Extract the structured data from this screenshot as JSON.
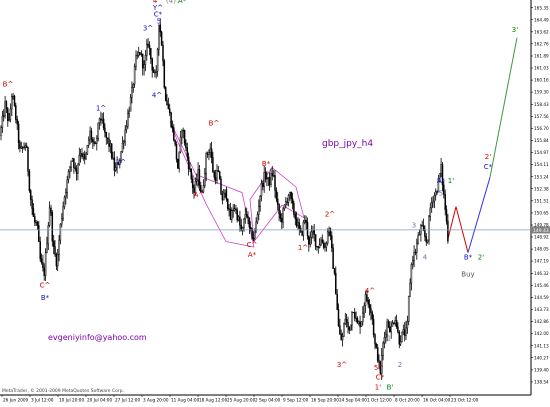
{
  "chart_data": {
    "type": "candlestick",
    "title": "gbp_jpy_h4",
    "annotations": {
      "email": "evgeniyinfo@yahoo.com",
      "copyright": "MetaTrader, © 2001-2009 MetaQuotes Software Corp.",
      "buy": "Buy"
    },
    "price_scale": {
      "ylim": [
        137.6,
        165.9
      ],
      "ticks": [
        "165.35",
        "164.49",
        "163.62",
        "162.76",
        "161.89",
        "161.03",
        "160.16",
        "159.30",
        "158.43",
        "157.56",
        "156.70",
        "155.84",
        "154.97",
        "154.11",
        "153.24",
        "152.38",
        "151.51",
        "150.65",
        "149.78",
        "148.92",
        "148.05",
        "147.19",
        "146.32",
        "145.46",
        "144.59",
        "143.73",
        "142.86",
        "142.00",
        "141.13",
        "140.27",
        "139.40",
        "138.54"
      ],
      "current_price": "149.43",
      "current_price_value": 149.43
    },
    "time_scale": {
      "ticks": [
        "26 Jun 2009",
        "3 Jul 12:00",
        "10 Jul 20:00",
        "20 Jul 04:00",
        "27 Jul 12:00",
        "3 Aug 20:00",
        "11 Aug 04:00",
        "18 Aug 12:00",
        "25 Aug 20:00",
        "2 Sep 04:00",
        "9 Sep 12:00",
        "16 Sep 20:00",
        "24 Sep 04:00",
        "1 Oct 12:00",
        "8 Oct 20:00",
        "16 Oct 04:00",
        "23 Oct 12:00"
      ]
    },
    "price_path": [
      [
        0,
        156.2
      ],
      [
        5,
        158.4
      ],
      [
        9,
        157.0
      ],
      [
        12,
        159.3
      ],
      [
        16,
        157.4
      ],
      [
        20,
        155.0
      ],
      [
        26,
        155.6
      ],
      [
        30,
        152.0
      ],
      [
        34,
        150.0
      ],
      [
        37,
        149.8
      ],
      [
        40,
        147.3
      ],
      [
        44,
        146.2
      ],
      [
        47,
        148.8
      ],
      [
        50,
        151.5
      ],
      [
        53,
        148.2
      ],
      [
        57,
        147.0
      ],
      [
        60,
        149.5
      ],
      [
        64,
        151.7
      ],
      [
        68,
        153.2
      ],
      [
        72,
        154.8
      ],
      [
        76,
        153.4
      ],
      [
        80,
        155.2
      ],
      [
        85,
        154.3
      ],
      [
        90,
        156.4
      ],
      [
        95,
        155.1
      ],
      [
        100,
        157.7
      ],
      [
        105,
        156.2
      ],
      [
        110,
        155.4
      ],
      [
        115,
        153.6
      ],
      [
        120,
        154.6
      ],
      [
        126,
        156.9
      ],
      [
        132,
        159.3
      ],
      [
        136,
        161.6
      ],
      [
        140,
        162.2
      ],
      [
        144,
        161.0
      ],
      [
        148,
        163.0
      ],
      [
        152,
        161.2
      ],
      [
        156,
        160.1
      ],
      [
        159,
        164.5
      ],
      [
        162,
        162.6
      ],
      [
        165,
        159.2
      ],
      [
        170,
        157.6
      ],
      [
        174,
        156.0
      ],
      [
        178,
        153.8
      ],
      [
        182,
        156.9
      ],
      [
        186,
        155.2
      ],
      [
        190,
        153.6
      ],
      [
        194,
        152.1
      ],
      [
        198,
        153.5
      ],
      [
        202,
        151.8
      ],
      [
        206,
        154.6
      ],
      [
        210,
        155.4
      ],
      [
        214,
        153.1
      ],
      [
        218,
        153.6
      ],
      [
        222,
        151.6
      ],
      [
        226,
        152.2
      ],
      [
        230,
        150.1
      ],
      [
        234,
        151.2
      ],
      [
        238,
        150.3
      ],
      [
        242,
        149.1
      ],
      [
        246,
        150.9
      ],
      [
        250,
        149.2
      ],
      [
        254,
        148.9
      ],
      [
        257,
        150.3
      ],
      [
        261,
        152.4
      ],
      [
        265,
        153.4
      ],
      [
        269,
        152.8
      ],
      [
        273,
        153.6
      ],
      [
        277,
        151.2
      ],
      [
        281,
        150.0
      ],
      [
        285,
        151.2
      ],
      [
        289,
        152.1
      ],
      [
        293,
        150.9
      ],
      [
        297,
        149.9
      ],
      [
        301,
        149.0
      ],
      [
        305,
        150.3
      ],
      [
        309,
        148.5
      ],
      [
        313,
        149.3
      ],
      [
        317,
        148.2
      ],
      [
        321,
        148.7
      ],
      [
        325,
        148.2
      ],
      [
        329,
        149.7
      ],
      [
        333,
        147.0
      ],
      [
        336,
        145.0
      ],
      [
        339,
        142.0
      ],
      [
        342,
        141.4
      ],
      [
        345,
        143.2
      ],
      [
        349,
        142.1
      ],
      [
        353,
        144.0
      ],
      [
        357,
        142.6
      ],
      [
        361,
        142.8
      ],
      [
        365,
        144.6
      ],
      [
        369,
        144.3
      ],
      [
        372,
        143.3
      ],
      [
        375,
        141.1
      ],
      [
        378,
        140.3
      ],
      [
        380,
        139.0
      ],
      [
        383,
        141.2
      ],
      [
        387,
        142.8
      ],
      [
        391,
        142.3
      ],
      [
        395,
        143.3
      ],
      [
        399,
        141.5
      ],
      [
        403,
        142.0
      ],
      [
        407,
        142.1
      ],
      [
        409,
        144.9
      ],
      [
        412,
        147.4
      ],
      [
        415,
        147.8
      ],
      [
        418,
        148.8
      ],
      [
        421,
        149.6
      ],
      [
        424,
        149.1
      ],
      [
        427,
        148.5
      ],
      [
        430,
        150.9
      ],
      [
        433,
        151.8
      ],
      [
        436,
        152.1
      ],
      [
        439,
        153.1
      ],
      [
        441,
        153.9
      ],
      [
        444,
        151.7
      ],
      [
        446,
        150.4
      ],
      [
        448,
        148.8
      ]
    ],
    "wave_labels": [
      {
        "text": "B^",
        "color": "#d40000",
        "t": 8,
        "p": 159.7
      },
      {
        "text": "C^",
        "color": "#d40000",
        "t": 45,
        "p": 145.3
      },
      {
        "text": "B*",
        "color": "#1010cc",
        "t": 45,
        "p": 144.4
      },
      {
        "text": "1^",
        "color": "#1010cc",
        "t": 101,
        "p": 158.0
      },
      {
        "text": "2^",
        "color": "#1010cc",
        "t": 121,
        "p": 154.1
      },
      {
        "text": "3^",
        "color": "#1010cc",
        "t": 148,
        "p": 163.7
      },
      {
        "text": "4^",
        "color": "#1010cc",
        "t": 157,
        "p": 158.9
      },
      {
        "text": "4^",
        "color": "#d40000",
        "t": 158,
        "p": 165.7
      },
      {
        "text": "Y^",
        "color": "#1010cc",
        "t": 158,
        "p": 165.2
      },
      {
        "text": "C*",
        "color": "#1010cc",
        "t": 158,
        "p": 164.7
      },
      {
        "text": "5",
        "color": "#1010cc",
        "t": 159,
        "p": 164.2
      },
      {
        "text": "(4)",
        "color": "#808080",
        "t": 171,
        "p": 165.7
      },
      {
        "text": "A*",
        "color": "#008000",
        "t": 182,
        "p": 165.7
      },
      {
        "text": "A^",
        "color": "#d40000",
        "t": 199,
        "p": 151.8
      },
      {
        "text": "B^",
        "color": "#d40000",
        "t": 214,
        "p": 156.9
      },
      {
        "text": "C^",
        "color": "#d40000",
        "t": 252,
        "p": 148.2
      },
      {
        "text": "A*",
        "color": "#d40000",
        "t": 252,
        "p": 147.5
      },
      {
        "text": "B*",
        "color": "#d40000",
        "t": 266,
        "p": 154.0
      },
      {
        "text": "1^",
        "color": "#d40000",
        "t": 303,
        "p": 148.0
      },
      {
        "text": "2^",
        "color": "#d40000",
        "t": 330,
        "p": 150.4
      },
      {
        "text": "3^",
        "color": "#d40000",
        "t": 342,
        "p": 139.6
      },
      {
        "text": "4^",
        "color": "#d40000",
        "t": 370,
        "p": 144.9
      },
      {
        "text": "5^",
        "color": "#d40000",
        "t": 379,
        "p": 139.4
      },
      {
        "text": "C*",
        "color": "#d40000",
        "t": 380,
        "p": 138.7
      },
      {
        "text": "1'",
        "color": "#d40000",
        "t": 378,
        "p": 138.0
      },
      {
        "text": "B'",
        "color": "#008000",
        "t": 390,
        "p": 138.0
      },
      {
        "text": "1",
        "color": "#6677aa",
        "t": 389,
        "p": 141.5
      },
      {
        "text": "2",
        "color": "#6677aa",
        "t": 400,
        "p": 139.6
      },
      {
        "text": "3",
        "color": "#6677aa",
        "t": 414,
        "p": 149.6
      },
      {
        "text": "4",
        "color": "#6677aa",
        "t": 425,
        "p": 147.3
      },
      {
        "text": "5",
        "color": "#6677aa",
        "t": 441,
        "p": 151.9
      },
      {
        "text": "A*",
        "color": "#1010cc",
        "t": 441,
        "p": 152.8
      },
      {
        "text": "1'",
        "color": "#008000",
        "t": 451,
        "p": 152.8
      },
      {
        "text": "B*",
        "color": "#1010cc",
        "t": 468,
        "p": 147.3
      },
      {
        "text": "2'",
        "color": "#008000",
        "t": 481,
        "p": 147.3
      },
      {
        "text": "Buy",
        "color": "#555555",
        "t": 468,
        "p": 146.1
      },
      {
        "text": "2'",
        "color": "#d40000",
        "t": 488,
        "p": 154.5
      },
      {
        "text": "C*",
        "color": "#1010cc",
        "t": 488,
        "p": 153.8
      },
      {
        "text": "3'",
        "color": "#008000",
        "t": 515,
        "p": 163.6
      }
    ],
    "projections": [
      {
        "color": "#d40000",
        "points": [
          [
            448,
            148.8
          ],
          [
            456,
            151.1
          ],
          [
            468,
            147.8
          ]
        ]
      },
      {
        "color": "#3333ee",
        "points": [
          [
            468,
            147.8
          ],
          [
            490,
            153.2
          ]
        ]
      },
      {
        "color": "#3a9a3a",
        "points": [
          [
            490,
            153.2
          ],
          [
            517,
            163.2
          ]
        ]
      }
    ],
    "channels": [
      {
        "color": "#cc44cc",
        "points": [
          [
            170,
            157.2
          ],
          [
            196,
            153.4
          ],
          [
            242,
            152.1
          ],
          [
            254,
            148.2
          ],
          [
            226,
            148.6
          ],
          [
            206,
            151.3
          ],
          [
            178,
            155.7
          ],
          [
            170,
            157.2
          ]
        ]
      },
      {
        "color": "#cc44cc",
        "points": [
          [
            250,
            151.6
          ],
          [
            272,
            153.9
          ],
          [
            296,
            152.5
          ],
          [
            304,
            150.3
          ],
          [
            282,
            151.2
          ],
          [
            254,
            148.6
          ],
          [
            250,
            151.6
          ]
        ]
      }
    ]
  }
}
